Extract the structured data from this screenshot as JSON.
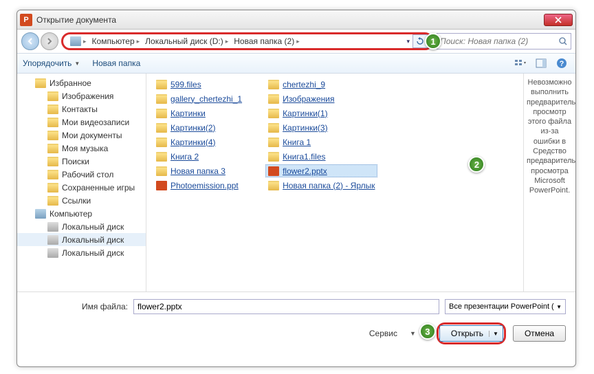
{
  "window": {
    "title": "Открытие документа"
  },
  "breadcrumb": {
    "segments": [
      "Компьютер",
      "Локальный диск (D:)",
      "Новая папка (2)"
    ]
  },
  "search": {
    "placeholder": "Поиск: Новая папка (2)"
  },
  "toolbar": {
    "organize": "Упорядочить",
    "newfolder": "Новая папка"
  },
  "sidebar": {
    "items": [
      {
        "label": "Избранное",
        "icon": "star"
      },
      {
        "label": "Изображения",
        "icon": "folder",
        "indent": 2
      },
      {
        "label": "Контакты",
        "icon": "folder",
        "indent": 2
      },
      {
        "label": "Мои видеозаписи",
        "icon": "folder",
        "indent": 2
      },
      {
        "label": "Мои документы",
        "icon": "folder",
        "indent": 2
      },
      {
        "label": "Моя музыка",
        "icon": "folder",
        "indent": 2
      },
      {
        "label": "Поиски",
        "icon": "folder",
        "indent": 2
      },
      {
        "label": "Рабочий стол",
        "icon": "folder",
        "indent": 2
      },
      {
        "label": "Сохраненные игры",
        "icon": "folder",
        "indent": 2
      },
      {
        "label": "Ссылки",
        "icon": "folder",
        "indent": 2
      },
      {
        "label": "Компьютер",
        "icon": "pc"
      },
      {
        "label": "Локальный диск",
        "icon": "drive",
        "indent": 2
      },
      {
        "label": "Локальный диск",
        "icon": "drive",
        "indent": 2,
        "sel": true
      },
      {
        "label": "Локальный диск",
        "icon": "drive",
        "indent": 2
      }
    ]
  },
  "files": {
    "col1": [
      {
        "label": "599.files",
        "icon": "folder"
      },
      {
        "label": "gallery_chertezhi_1",
        "icon": "folder"
      },
      {
        "label": "Картинки",
        "icon": "folder"
      },
      {
        "label": "Картинки(2)",
        "icon": "folder"
      },
      {
        "label": "Картинки(4)",
        "icon": "folder"
      },
      {
        "label": "Книга 2",
        "icon": "folder"
      },
      {
        "label": "Новая папка 3",
        "icon": "folder"
      },
      {
        "label": "Photoemission.ppt",
        "icon": "ppt"
      }
    ],
    "col2": [
      {
        "label": "chertezhi_9",
        "icon": "folder"
      },
      {
        "label": "Изображения",
        "icon": "folder"
      },
      {
        "label": "Картинки(1)",
        "icon": "folder"
      },
      {
        "label": "Картинки(3)",
        "icon": "folder"
      },
      {
        "label": "Книга 1",
        "icon": "folder"
      },
      {
        "label": "Книга1.files",
        "icon": "folder"
      },
      {
        "label": "flower2.pptx",
        "icon": "ppt",
        "sel": true
      },
      {
        "label": "Новая папка (2) - Ярлык",
        "icon": "shortcut"
      }
    ]
  },
  "preview": {
    "text": "Невозможно выполнить предварительный просмотр этого файла из-за ошибки в Средство предварительного просмотра Microsoft PowerPoint."
  },
  "footer": {
    "filename_label": "Имя файла:",
    "filename_value": "flower2.pptx",
    "filetype": "Все презентации PowerPoint (",
    "service": "Сервис",
    "open": "Открыть",
    "cancel": "Отмена"
  },
  "badges": {
    "b1": "1",
    "b2": "2",
    "b3": "3"
  }
}
